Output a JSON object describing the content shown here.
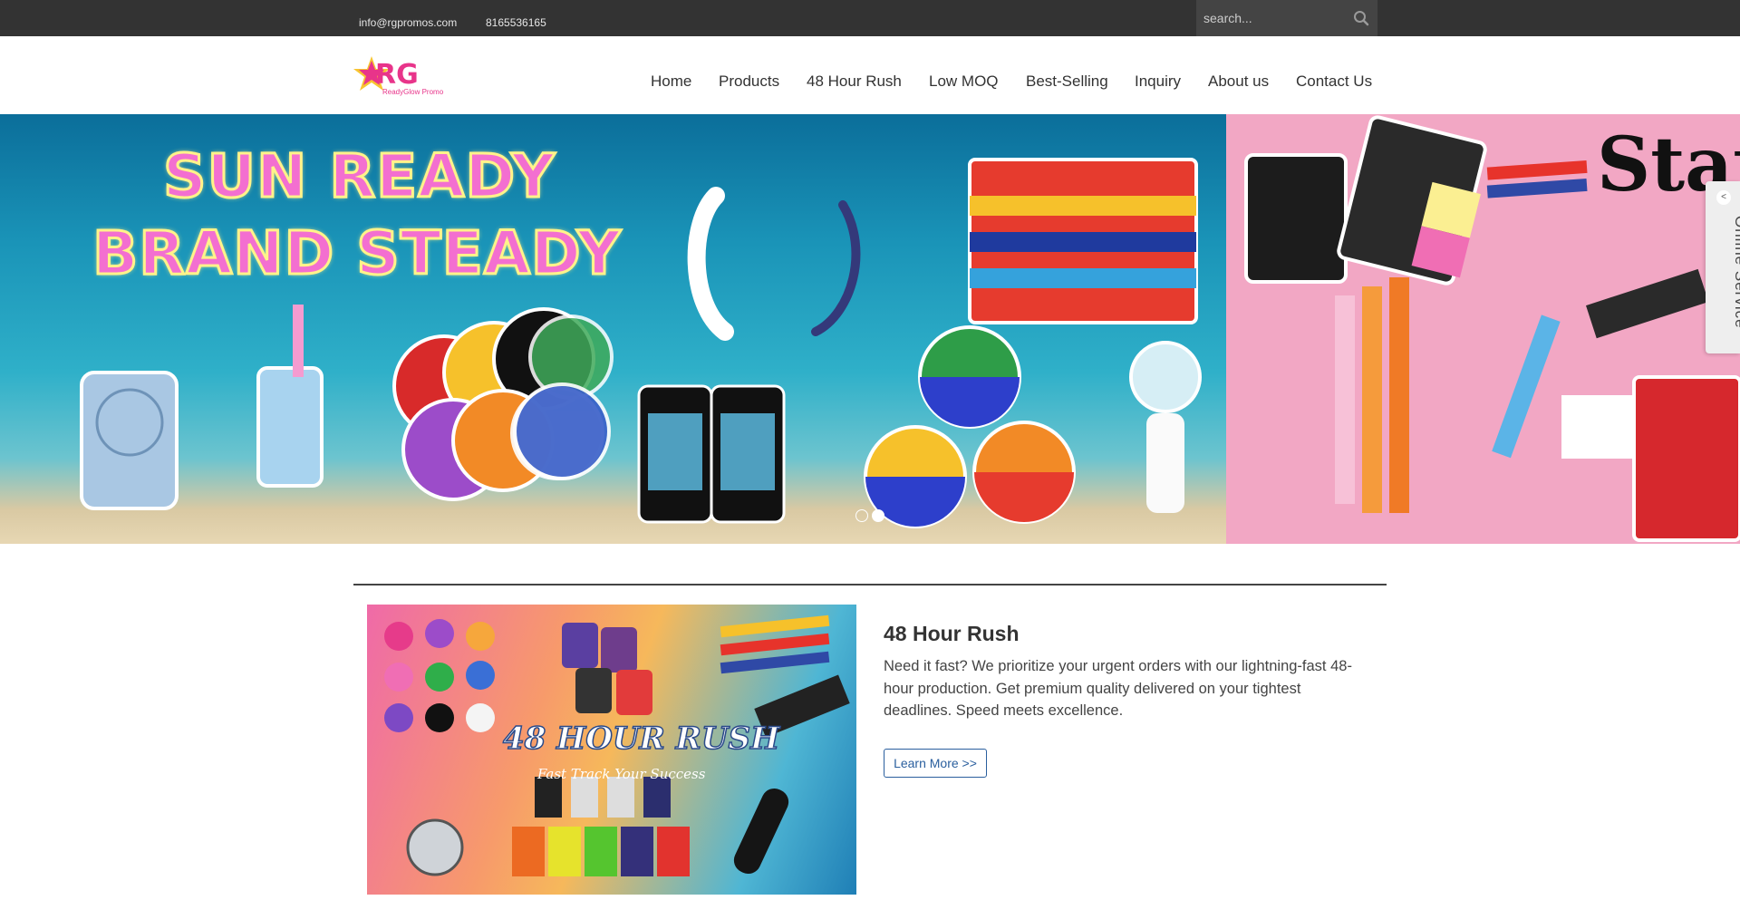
{
  "topbar": {
    "email": "info@rgpromos.com",
    "phone": "8165536165",
    "search_placeholder": "search..."
  },
  "header": {
    "logo_text": "RG",
    "logo_subtext": "ReadyGlow Promo",
    "nav": [
      "Home",
      "Products",
      "48 Hour Rush",
      "Low MOQ",
      "Best-Selling",
      "Inquiry",
      "About us",
      "Contact Us"
    ]
  },
  "banner": {
    "slide1_line1": "SUN READY",
    "slide1_line2": "BRAND STEADY",
    "slide2_heading": "Stat",
    "dots": 2,
    "active_dot": 2
  },
  "online_service": {
    "label": "Online Service",
    "toggle_glyph": "<"
  },
  "feature": {
    "image_title": "48 HOUR RUSH",
    "image_subtitle": "Fast Track Your Success",
    "title": "48 Hour Rush",
    "description": "Need it fast? We prioritize your urgent orders with our lightning-fast 48-hour production. Get premium quality delivered on your tightest deadlines. Speed meets excellence.",
    "button_label": "Learn More >>"
  },
  "colors": {
    "topbar_bg": "#333333",
    "search_bg": "#444444",
    "accent_blue": "#2a5f9e",
    "logo_pink": "#e8348a",
    "star_yellow": "#f7c531"
  }
}
